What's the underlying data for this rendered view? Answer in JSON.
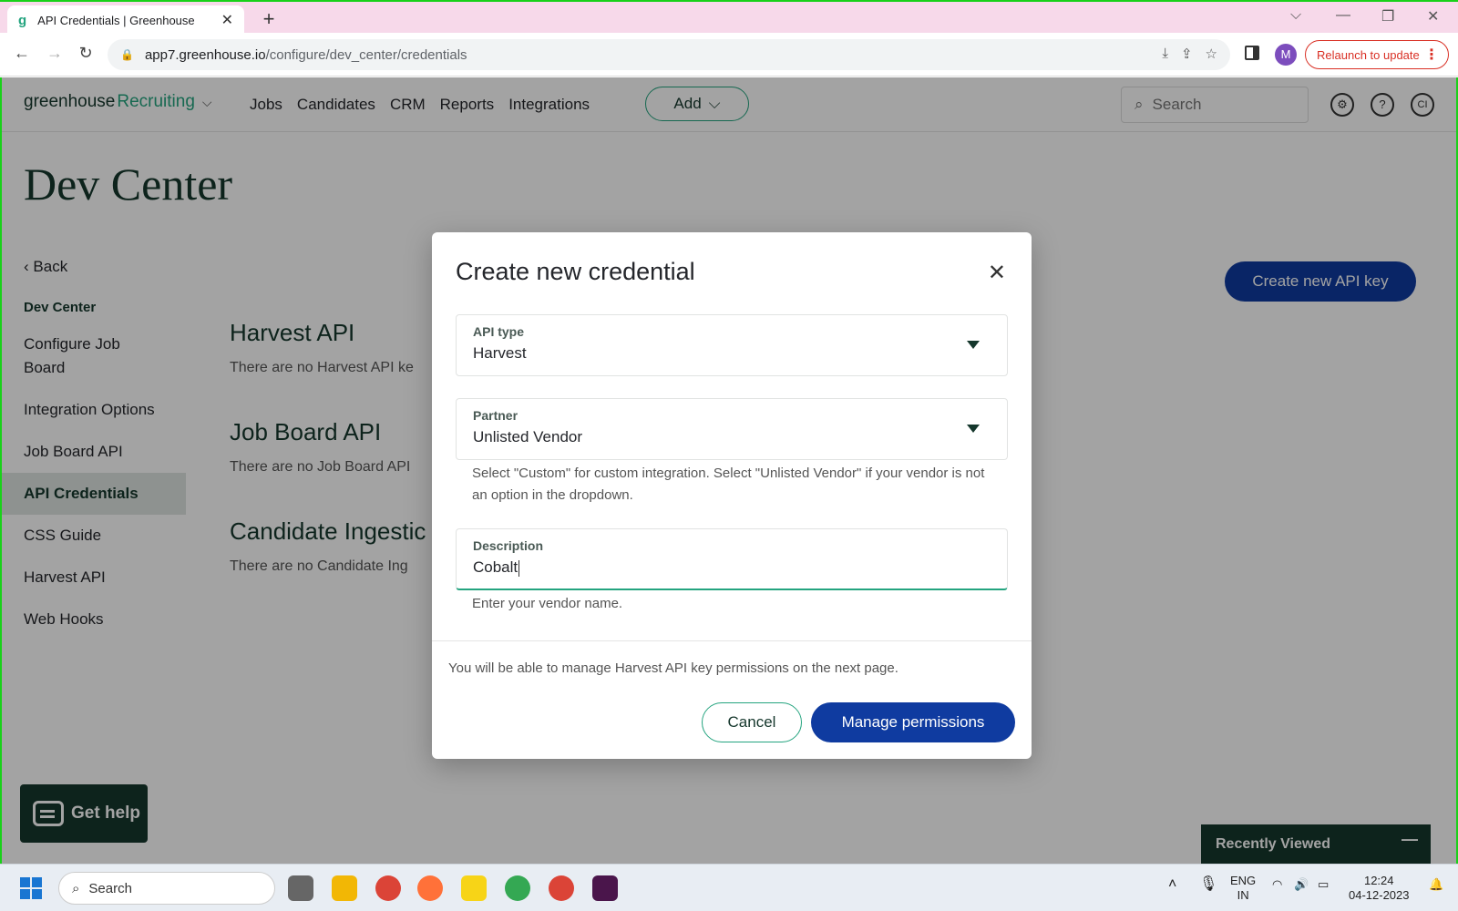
{
  "browser": {
    "tab_title": "API Credentials | Greenhouse",
    "url_host": "app7.greenhouse.io",
    "url_path": "/configure/dev_center/credentials",
    "profile_initial": "M",
    "relaunch_label": "Relaunch to update"
  },
  "appnav": {
    "logo_main": "greenhouse",
    "logo_product": "Recruiting",
    "links": [
      "Jobs",
      "Candidates",
      "CRM",
      "Reports",
      "Integrations"
    ],
    "add_label": "Add",
    "search_placeholder": "Search",
    "user_initials": "CI"
  },
  "page": {
    "title": "Dev Center",
    "back_label": "Back",
    "sidebar_heading": "Dev Center",
    "sidebar_items": [
      "Configure Job Board",
      "Integration Options",
      "Job Board API",
      "API Credentials",
      "CSS Guide",
      "Harvest API",
      "Web Hooks"
    ],
    "active_item": "API Credentials",
    "create_key_label": "Create new API key",
    "sections": [
      {
        "title": "Harvest API",
        "text": "There are no Harvest API ke"
      },
      {
        "title": "Job Board API",
        "text": "There are no Job Board API"
      },
      {
        "title": "Candidate Ingestic",
        "text": "There are no Candidate Ing"
      }
    ],
    "get_help_label": "Get help",
    "recently_viewed_label": "Recently Viewed"
  },
  "modal": {
    "title": "Create new credential",
    "api_type_label": "API type",
    "api_type_value": "Harvest",
    "partner_label": "Partner",
    "partner_value": "Unlisted Vendor",
    "partner_help": "Select \"Custom\" for custom integration. Select \"Unlisted Vendor\" if your vendor is not an option in the dropdown.",
    "description_label": "Description",
    "description_value": "Cobalt",
    "description_help": "Enter your vendor name.",
    "footnote": "You will be able to manage Harvest API key permissions on the next page.",
    "cancel_label": "Cancel",
    "manage_label": "Manage permissions"
  },
  "taskbar": {
    "search_placeholder": "Search",
    "lang_top": "ENG",
    "lang_bottom": "IN",
    "time": "12:24",
    "date": "04-12-2023"
  },
  "colors": {
    "brand_green": "#24a47f",
    "dark_green": "#15372c",
    "primary_blue": "#0f3ba0"
  }
}
